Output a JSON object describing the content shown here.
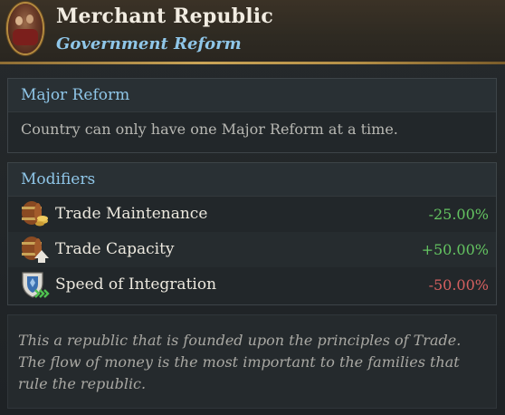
{
  "header": {
    "title": "Merchant Republic",
    "subtitle": "Government Reform",
    "portrait_icon": "merchant-republic-portrait"
  },
  "reform": {
    "heading": "Major Reform",
    "description": "Country can only have one Major Reform at a time."
  },
  "modifiers": {
    "heading": "Modifiers",
    "items": [
      {
        "icon": "trade-barrel-coins-icon",
        "label": "Trade Maintenance",
        "value": "-25.00%",
        "polarity": "positive"
      },
      {
        "icon": "trade-barrel-arrow-icon",
        "label": "Trade Capacity",
        "value": "+50.00%",
        "polarity": "positive"
      },
      {
        "icon": "shield-arrows-icon",
        "label": "Speed of Integration",
        "value": "-50.00%",
        "polarity": "negative"
      }
    ]
  },
  "flavor": {
    "text": "This a republic that is founded upon the principles of Trade. The flow of money is the most important to the families that rule the republic."
  },
  "colors": {
    "accent_blue": "#8fc6e8",
    "positive": "#64c461",
    "negative": "#d66060",
    "gold_rule": "#c9a457"
  }
}
